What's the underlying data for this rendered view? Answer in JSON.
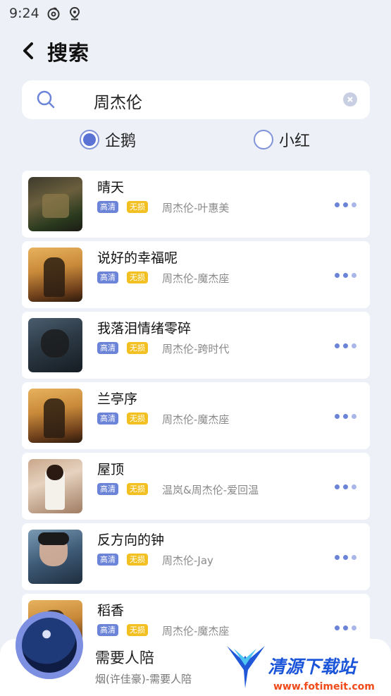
{
  "status_bar": {
    "time": "9:24"
  },
  "header": {
    "title": "搜索"
  },
  "search": {
    "value": "周杰伦"
  },
  "source_options": [
    {
      "label": "企鹅",
      "selected": true
    },
    {
      "label": "小红",
      "selected": false
    }
  ],
  "songs": [
    {
      "title": "晴天",
      "tag_hq": "高清",
      "tag_lossless": "无损",
      "meta": "周杰伦-叶惠美"
    },
    {
      "title": "说好的幸福呢",
      "tag_hq": "高清",
      "tag_lossless": "无损",
      "meta": "周杰伦-魔杰座"
    },
    {
      "title": "我落泪情绪零碎",
      "tag_hq": "高清",
      "tag_lossless": "无损",
      "meta": "周杰伦-跨时代"
    },
    {
      "title": "兰亭序",
      "tag_hq": "高清",
      "tag_lossless": "无损",
      "meta": "周杰伦-魔杰座"
    },
    {
      "title": "屋顶",
      "tag_hq": "高清",
      "tag_lossless": "无损",
      "meta": "温岚&周杰伦-爱回温"
    },
    {
      "title": "反方向的钟",
      "tag_hq": "高清",
      "tag_lossless": "无损",
      "meta": "周杰伦-Jay"
    },
    {
      "title": "稻香",
      "tag_hq": "高清",
      "tag_lossless": "无损",
      "meta": "周杰伦-魔杰座"
    }
  ],
  "player": {
    "title": "需要人陪",
    "subtitle": "烟(许佳豪)-需要人陪"
  },
  "watermark": {
    "text": "清源下载站",
    "url": "www.fotimeit.com"
  },
  "colors": {
    "accent": "#6b84d8",
    "lossless": "#f2c021",
    "background": "#eef0f8"
  }
}
